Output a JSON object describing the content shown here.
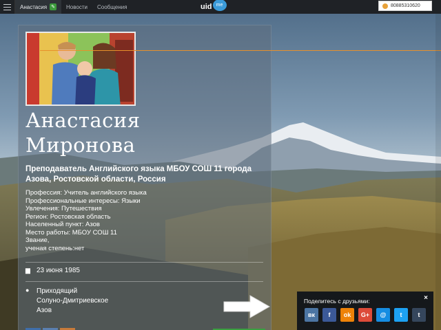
{
  "nav": {
    "items": [
      {
        "label": "Анастасия",
        "active": true
      },
      {
        "label": "Новости"
      },
      {
        "label": "Сообщения"
      }
    ],
    "edit_icon": "pencil-icon",
    "menu_icon": "hamburger-icon"
  },
  "logo": {
    "text": "uid",
    "badge": "me"
  },
  "account": {
    "id": "80885310620",
    "icon": "user-icon"
  },
  "profile": {
    "name_line1": "Анастасия",
    "name_line2": "Миронова",
    "headline": "Преподаватель Английского языка МБОУ СОШ 11 города Азова, Ростовской области, Россия",
    "info": [
      "Профессия: Учитель английского языка",
      "Профессиональные интересы: Языки",
      "Увлечения: Путешествия",
      "Регион: Ростовская область",
      "Населенный пункт: Азов",
      "Место работы: МБОУ СОШ 11",
      "Звание,",
      "ученая степень:нет"
    ],
    "birthday": "23 июня 1985",
    "birthday_icon": "cake-icon",
    "location_icon": "map-pin-icon",
    "location": [
      "Приходящий",
      "Солуно-Дмитриевское",
      "Азов"
    ]
  },
  "share": {
    "title": "Поделитесь с друзьями:",
    "close": "×",
    "buttons": [
      {
        "label": "вк",
        "icon": "vk-icon",
        "color": "#4c75a3"
      },
      {
        "label": "f",
        "icon": "facebook-icon",
        "color": "#3b5998"
      },
      {
        "label": "ok",
        "icon": "odnoklassniki-icon",
        "color": "#ee8208"
      },
      {
        "label": "G+",
        "icon": "google-plus-icon",
        "color": "#dd4b39"
      },
      {
        "label": "@",
        "icon": "mailru-icon",
        "color": "#168de2"
      },
      {
        "label": "t",
        "icon": "twitter-icon",
        "color": "#1da1f2"
      },
      {
        "label": "t",
        "icon": "tumblr-icon",
        "color": "#35465c"
      }
    ]
  },
  "colors": {
    "accent": "#3b9bd9",
    "topbar": "#1f2226",
    "guide_line": "#e8902a"
  }
}
